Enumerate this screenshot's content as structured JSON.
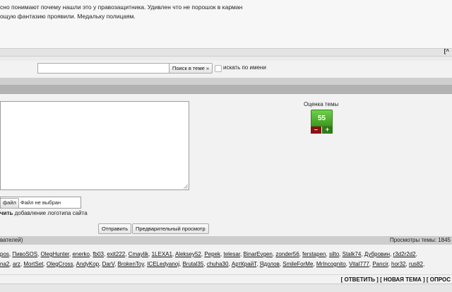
{
  "post": {
    "line1": "сно понимают почему нашли это у правозащитника. Удивлен что не порошок в карман",
    "line2": "ощую фантазию проявили. Медальку полицаям."
  },
  "nav": {
    "top_link": "[^"
  },
  "search": {
    "input_value": "",
    "button_label": "Поиск в теме »",
    "checkbox_label": "искать по имени"
  },
  "rating": {
    "title": "Оценка темы",
    "score": "55",
    "minus": "–",
    "plus": "+"
  },
  "attach": {
    "button_label": "файл",
    "no_file": "Файл не выбран"
  },
  "logo": {
    "bold": "чить",
    "text": " добавление логотипа сайта"
  },
  "buttons": {
    "send": "Отправить",
    "preview": "Предварительный просмотр"
  },
  "stats": {
    "left": "вателей)",
    "right": "Просмотры темы: 1845"
  },
  "users_line1": [
    "pos",
    "ПивоSOS",
    "OlegHunter",
    "enerko",
    "fb03",
    "exit222",
    "Cmaylik",
    "1LEXA1",
    "Aleksey52",
    "Pepek",
    "telesar",
    "BinarEvgen",
    "zonder56",
    "ferstapen",
    "silto",
    "Stalk74",
    "Дубровин",
    "r3d2r2d2"
  ],
  "users_line2": [
    "na2",
    "arz",
    "MortSet",
    "OlegCross",
    "AndyKop",
    "DarV",
    "BrokenToy",
    "ICELedyanoj",
    "Brutal35",
    "chuha30",
    "АртКрайТ",
    "Ядолов",
    "SmileForMe",
    "MrIncognito",
    "Vital777",
    "Pancir",
    "hor32",
    "rus82"
  ],
  "bottom_nav": {
    "reply": "[ ОТВЕТИТЬ ]",
    "new_topic": "[ НОВАЯ ТЕМА ]",
    "poll": "[ ОПРОС"
  }
}
